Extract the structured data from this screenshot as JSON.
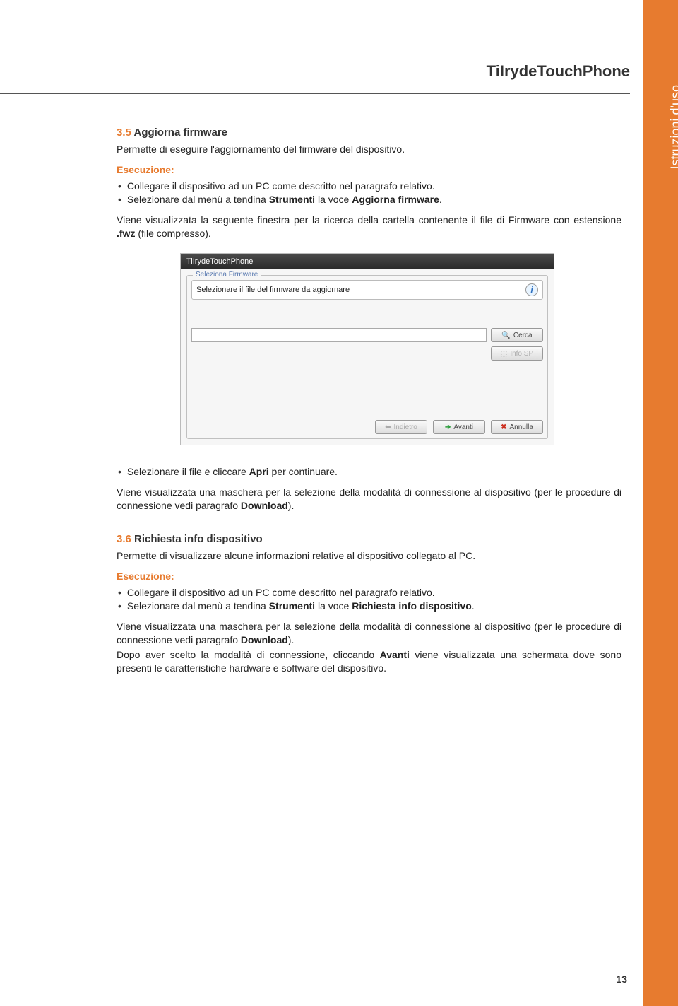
{
  "sidebar_label": "Istruzioni d'uso",
  "header_title": "TiIrydeTouchPhone",
  "page_number": "13",
  "sec35": {
    "num": "3.5",
    "title": "Aggiorna firmware",
    "intro": "Permette di eseguire l'aggiornamento del firmware del dispositivo.",
    "exec_label": "Esecuzione:",
    "bullets": [
      "Collegare il dispositivo ad un PC come descritto nel paragrafo relativo."
    ],
    "bullet2_pre": "Selezionare dal menù a tendina ",
    "bullet2_b1": "Strumenti",
    "bullet2_mid": " la voce ",
    "bullet2_b2": "Aggiorna firmware",
    "bullet2_post": ".",
    "para1_pre": "Viene visualizzata la seguente finestra per la ricerca della cartella contenente il file di Firmware con estensione ",
    "para1_b": ".fwz",
    "para1_post": " (file compresso).",
    "bullet3_pre": "Selezionare il file e cliccare ",
    "bullet3_b": "Apri",
    "bullet3_post": " per continuare.",
    "para2_pre": "Viene visualizzata una maschera per la selezione della modalità di connessione al dispositivo (per le procedure di connessione vedi paragrafo ",
    "para2_b": "Download",
    "para2_post": ")."
  },
  "sec36": {
    "num": "3.6",
    "title": "Richiesta info dispositivo",
    "intro": "Permette di visualizzare alcune informazioni relative al dispositivo collegato al PC.",
    "exec_label": "Esecuzione:",
    "bullets": [
      "Collegare il dispositivo ad un PC come descritto nel paragrafo relativo."
    ],
    "bullet2_pre": "Selezionare dal menù a tendina ",
    "bullet2_b1": "Strumenti",
    "bullet2_mid": " la voce ",
    "bullet2_b2": "Richiesta info dispositivo",
    "bullet2_post": ".",
    "para1_pre": "Viene visualizzata una maschera per la selezione della modalità di connessione al dispositivo (per le procedure di connessione vedi paragrafo ",
    "para1_b": "Download",
    "para1_post": ").",
    "para2_pre": "Dopo aver scelto la modalità di connessione, cliccando ",
    "para2_b": "Avanti",
    "para2_post": " viene visualizzata una schermata dove sono presenti le caratteristiche hardware e software del dispositivo."
  },
  "screenshot": {
    "title": "TiIrydeTouchPhone",
    "group_label": "Seleziona Firmware",
    "msg": "Selezionare il file del firmware da aggiornare",
    "btn_cerca": "Cerca",
    "btn_info": "Info SP",
    "btn_indietro": "Indietro",
    "btn_avanti": "Avanti",
    "btn_annulla": "Annulla"
  }
}
